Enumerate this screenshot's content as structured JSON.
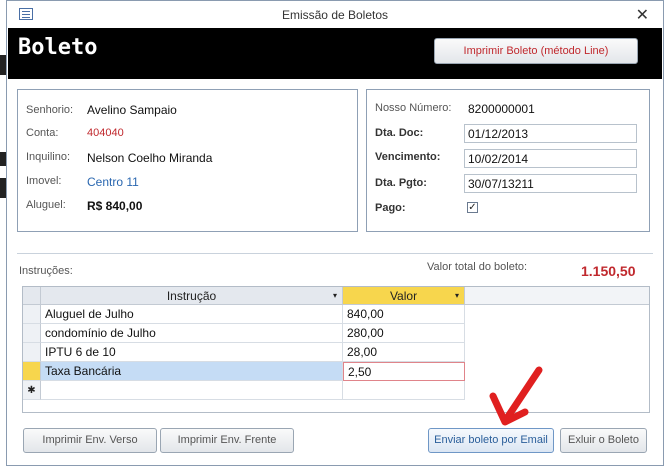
{
  "window": {
    "title": "Emissão de Boletos",
    "close_symbol": "✕"
  },
  "header": {
    "title": "Boleto",
    "print_button": "Imprimir Boleto (método Line)"
  },
  "left_panel": {
    "senhorio": {
      "label": "Senhorio:",
      "value": "Avelino Sampaio"
    },
    "conta": {
      "label": "Conta:",
      "value": "404040"
    },
    "inquilino": {
      "label": "Inquilino:",
      "value": "Nelson Coelho Miranda"
    },
    "imovel": {
      "label": "Imovel:",
      "value": "Centro 11"
    },
    "aluguel": {
      "label": "Aluguel:",
      "value": "R$ 840,00"
    }
  },
  "right_panel": {
    "nosso_numero": {
      "label": "Nosso Número:",
      "value": "8200000001"
    },
    "dta_doc": {
      "label": "Dta. Doc:",
      "value": "01/12/2013"
    },
    "vencimento": {
      "label": "Vencimento:",
      "value": "10/02/2014"
    },
    "dta_pgto": {
      "label": "Dta. Pgto:",
      "value": "30/07/13211"
    },
    "pago": {
      "label": "Pago:",
      "checked": true,
      "mark": "✓"
    }
  },
  "instrucoes": {
    "label": "Instruções:",
    "total_label": "Valor total  do boleto:",
    "total_value": "1.150,50",
    "columns": [
      "Instrução",
      "Valor"
    ],
    "rows": [
      {
        "instrucao": "Aluguel de Julho",
        "valor": "840,00"
      },
      {
        "instrucao": "condomínio de Julho",
        "valor": "280,00"
      },
      {
        "instrucao": "IPTU 6 de 10",
        "valor": "28,00"
      },
      {
        "instrucao": "Taxa Bancária",
        "valor": "2,50"
      }
    ],
    "new_row_marker": "✱"
  },
  "footer": {
    "verso_button": "Imprimir Env. Verso",
    "frente_button": "Imprimir Env. Frente",
    "email_button": "Enviar boleto por Email",
    "exit_button": "Exluir o Boleto"
  },
  "colors": {
    "accent_red": "#c0282d",
    "link_blue": "#2a67b0",
    "header_bg": "#000000",
    "arrow_red": "#e02020"
  }
}
